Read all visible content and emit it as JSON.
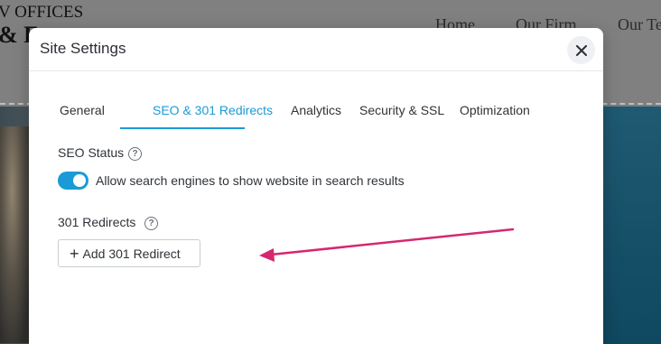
{
  "background_site": {
    "logo_line1": "V OFFICES",
    "logo_line2": "& F",
    "nav": [
      "Home",
      "Our Firm",
      "Our Te"
    ]
  },
  "modal": {
    "title": "Site Settings",
    "close_icon": "close-icon",
    "tabs": [
      {
        "label": "General",
        "active": false
      },
      {
        "label": "SEO & 301 Redirects",
        "active": true
      },
      {
        "label": "Analytics",
        "active": false
      },
      {
        "label": "Security & SSL",
        "active": false
      },
      {
        "label": "Optimization",
        "active": false
      }
    ],
    "seo_status": {
      "label": "SEO Status",
      "help_icon": "help-icon",
      "toggle_on": true,
      "toggle_text": "Allow search engines to show website in search results"
    },
    "redirects": {
      "label": "301 Redirects",
      "help_icon": "help-icon",
      "add_button_icon": "plus-icon",
      "add_button_label": "Add 301 Redirect"
    }
  },
  "colors": {
    "accent": "#1a9bd7",
    "annotation_arrow": "#d6286e"
  }
}
